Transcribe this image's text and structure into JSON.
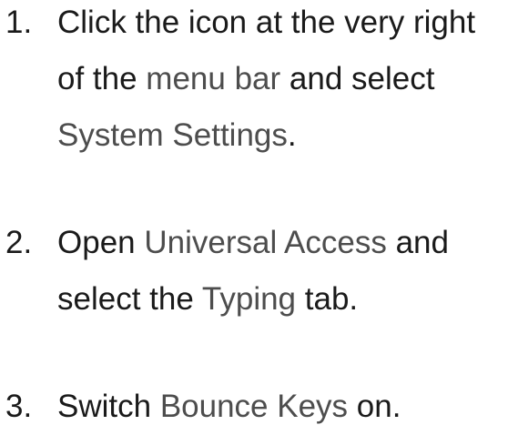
{
  "steps": [
    {
      "number": "1.",
      "parts": [
        {
          "text": "Click the icon at the very right of the ",
          "gui": false
        },
        {
          "text": "menu bar",
          "gui": true
        },
        {
          "text": " and select ",
          "gui": false
        },
        {
          "text": "System Settings",
          "gui": true
        },
        {
          "text": ".",
          "gui": false
        }
      ]
    },
    {
      "number": "2.",
      "parts": [
        {
          "text": "Open ",
          "gui": false
        },
        {
          "text": "Universal Access",
          "gui": true
        },
        {
          "text": " and select the ",
          "gui": false
        },
        {
          "text": "Typing",
          "gui": true
        },
        {
          "text": " tab.",
          "gui": false
        }
      ]
    },
    {
      "number": "3.",
      "parts": [
        {
          "text": "Switch ",
          "gui": false
        },
        {
          "text": "Bounce Keys",
          "gui": true
        },
        {
          "text": " on.",
          "gui": false
        }
      ]
    }
  ],
  "colors": {
    "body_text": "#1a1a1a",
    "gui_term": "#4d4d4d",
    "background": "#ffffff"
  }
}
